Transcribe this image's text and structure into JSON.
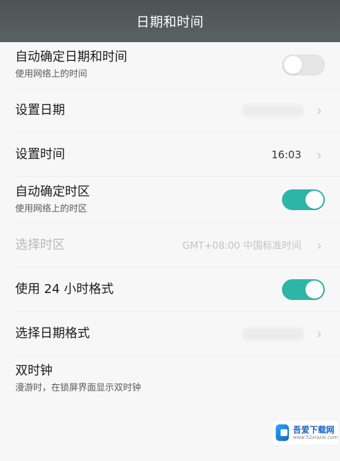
{
  "header": {
    "title": "日期和时间"
  },
  "rows": {
    "auto_datetime": {
      "title": "自动确定日期和时间",
      "subtitle": "使用网络上的时间",
      "toggle": "off"
    },
    "set_date": {
      "title": "设置日期"
    },
    "set_time": {
      "title": "设置时间",
      "value": "16:03"
    },
    "auto_timezone": {
      "title": "自动确定时区",
      "subtitle": "使用网络上的时区",
      "toggle": "on"
    },
    "select_timezone": {
      "title": "选择时区",
      "value": "GMT+08:00 中国标准时间",
      "disabled": true
    },
    "use_24h": {
      "title": "使用 24 小时格式",
      "toggle": "on"
    },
    "date_format": {
      "title": "选择日期格式"
    },
    "dual_clock": {
      "title": "双时钟",
      "subtitle": "漫游时，在锁屏界面显示双时钟"
    }
  },
  "watermark": {
    "title": "吾爱下载网",
    "url": "www.52xiazai.com"
  },
  "colors": {
    "accent": "#2db5a8",
    "header_bg": "#545b5b"
  }
}
